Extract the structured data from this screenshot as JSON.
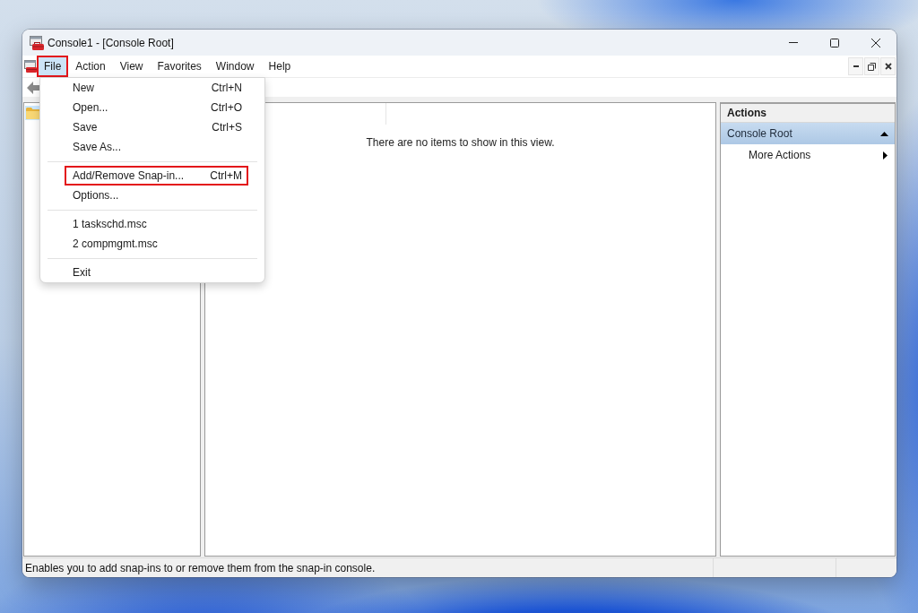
{
  "window": {
    "title": "Console1 - [Console Root]"
  },
  "menu_bar": {
    "items": [
      {
        "label": "File",
        "selected": true,
        "annotated": true
      },
      {
        "label": "Action",
        "selected": false,
        "annotated": false
      },
      {
        "label": "View",
        "selected": false,
        "annotated": false
      },
      {
        "label": "Favorites",
        "selected": false,
        "annotated": false
      },
      {
        "label": "Window",
        "selected": false,
        "annotated": false
      },
      {
        "label": "Help",
        "selected": false,
        "annotated": false
      }
    ]
  },
  "file_menu": {
    "items": [
      {
        "kind": "item",
        "label": "New",
        "shortcut": "Ctrl+N",
        "annotated": false
      },
      {
        "kind": "item",
        "label": "Open...",
        "shortcut": "Ctrl+O",
        "annotated": false
      },
      {
        "kind": "item",
        "label": "Save",
        "shortcut": "Ctrl+S",
        "annotated": false
      },
      {
        "kind": "item",
        "label": "Save As...",
        "annotated": false
      },
      {
        "kind": "separator"
      },
      {
        "kind": "item",
        "label": "Add/Remove Snap-in...",
        "shortcut": "Ctrl+M",
        "annotated": true
      },
      {
        "kind": "item",
        "label": "Options...",
        "annotated": false
      },
      {
        "kind": "separator"
      },
      {
        "kind": "item",
        "label": "1 taskschd.msc",
        "annotated": false
      },
      {
        "kind": "item",
        "label": "2 compmgmt.msc",
        "annotated": false
      },
      {
        "kind": "separator"
      },
      {
        "kind": "item",
        "label": "Exit",
        "annotated": false
      }
    ]
  },
  "tree": {
    "items": [
      {
        "selected": true
      }
    ]
  },
  "results_pane": {
    "empty_message": "There are no items to show in this view."
  },
  "actions_pane": {
    "title": "Actions",
    "sections": [
      {
        "label": "Console Root",
        "expanded": true,
        "items": [
          {
            "label": "More Actions",
            "has_submenu": true
          }
        ]
      }
    ]
  },
  "status_bar": {
    "text": "Enables you to add snap-ins to or remove them from the snap-in console."
  }
}
